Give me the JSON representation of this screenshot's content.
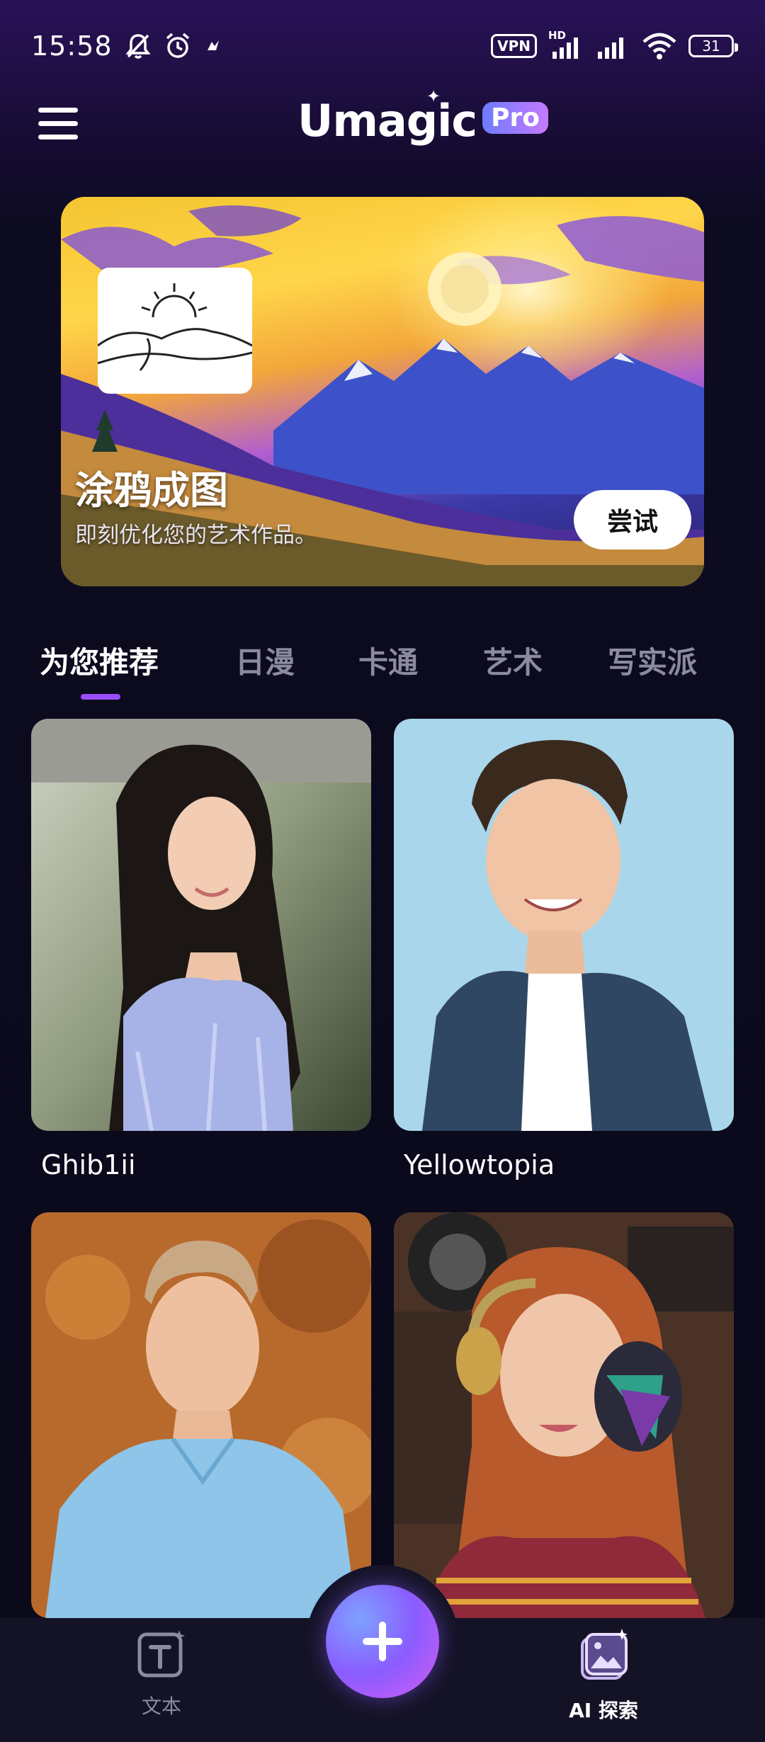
{
  "status_bar": {
    "time": "15:58",
    "vpn": "VPN",
    "network_type": "HD",
    "battery": "31"
  },
  "header": {
    "app_name": "Umagic",
    "badge": "Pro"
  },
  "banner": {
    "title": "涂鸦成图",
    "subtitle": "即刻优化您的艺术作品。",
    "button_label": "尝试"
  },
  "tabs": [
    {
      "label": "为您推荐",
      "active": true
    },
    {
      "label": "日漫",
      "active": false
    },
    {
      "label": "卡通",
      "active": false
    },
    {
      "label": "艺术",
      "active": false
    },
    {
      "label": "写实派",
      "active": false
    }
  ],
  "styles": [
    {
      "name": "Ghib1ii"
    },
    {
      "name": "Yellowtopia"
    },
    {
      "name": ""
    },
    {
      "name": ""
    }
  ],
  "bottom_nav": {
    "left_label": "文本",
    "right_label": "AI 探索"
  },
  "colors": {
    "accent": "#9a4dff",
    "background": "#0a0a1a",
    "nav_bg": "#141326"
  }
}
